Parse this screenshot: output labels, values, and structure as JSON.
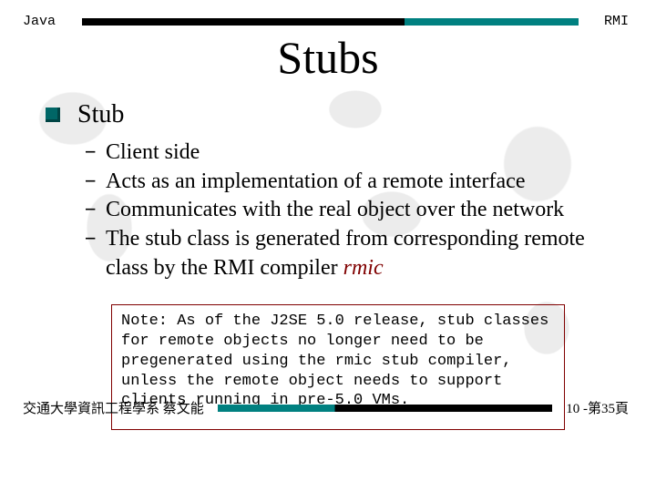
{
  "header": {
    "left": "Java",
    "right": "RMI"
  },
  "title": "Stubs",
  "bullet": {
    "heading": "Stub",
    "items": [
      "Client side",
      "Acts as an implementation of a remote interface",
      "Communicates with the real object over the network",
      "The stub class is generated from corresponding remote class by the RMI compiler "
    ],
    "rmic": "rmic"
  },
  "note": {
    "prefix": "Note: As of the J2SE 5.0 release, stub classes for remote objects no longer need to be pregenerated using the ",
    "rmic": "rmic",
    "suffix": " stub compiler, unless the remote object needs to support clients running in pre-5.0 VMs."
  },
  "footer": {
    "left": "交通大學資訊工程學系 蔡文能",
    "right": "10 -第35頁"
  }
}
